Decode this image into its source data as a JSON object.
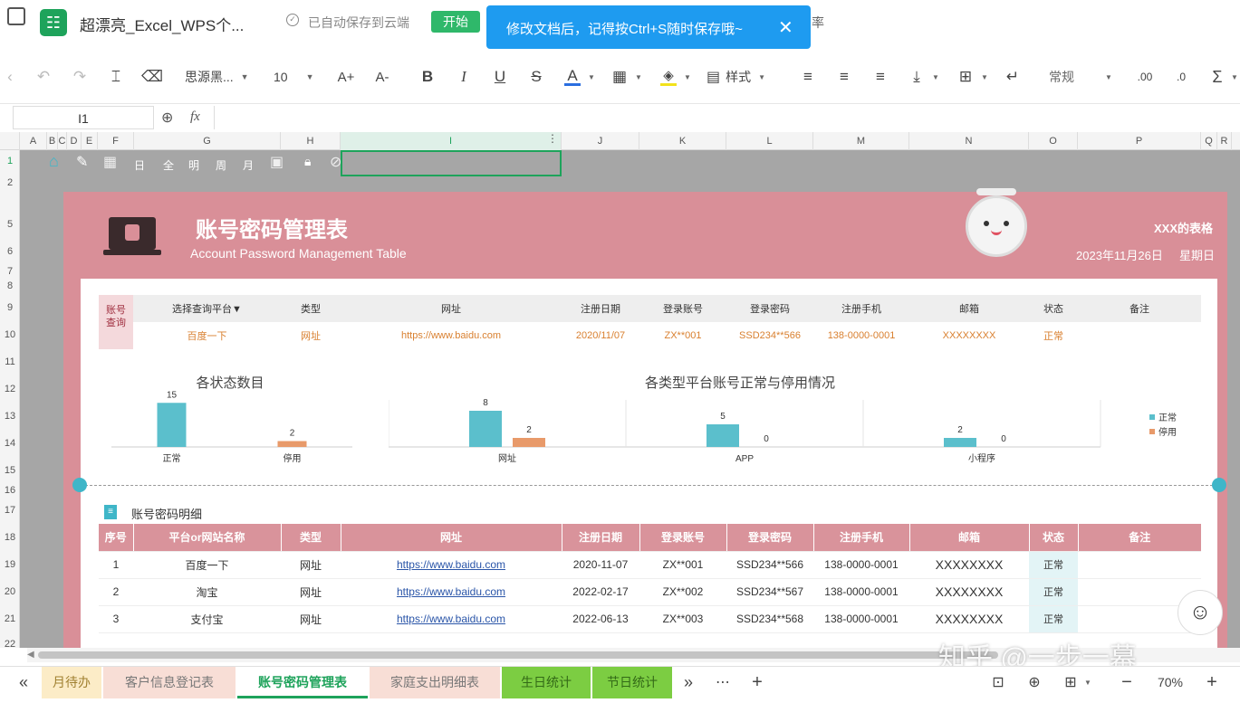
{
  "titlebar": {
    "doc_title": "超漂亮_Excel_WPS个...",
    "autosave": "已自动保存到云端",
    "start_button": "开始",
    "cut_text": "率",
    "notice": "修改文档后，记得按Ctrl+S随时保存哦~"
  },
  "toolbar": {
    "font_name": "思源黑...",
    "font_size": "10",
    "bold": "B",
    "italic": "I",
    "underline": "U",
    "strike": "S",
    "font_color": "A",
    "style_label": "样式",
    "number_format": "常规",
    "increase_font": "A+",
    "decrease_font": "A-",
    "decimal_a": ".00",
    "decimal_b": ".0",
    "sum": "Σ"
  },
  "formula": {
    "cell_ref": "I1",
    "fx": "fx"
  },
  "columns": [
    "A",
    "B",
    "C",
    "D",
    "E",
    "F",
    "G",
    "H",
    "I",
    "J",
    "K",
    "L",
    "M",
    "N",
    "O",
    "P",
    "Q",
    "R"
  ],
  "rows": [
    "1",
    "2",
    "5",
    "6",
    "7",
    "8",
    "9",
    "10",
    "11",
    "12",
    "13",
    "14",
    "15",
    "16",
    "17",
    "18",
    "19",
    "20",
    "21",
    "22"
  ],
  "row1_icons": [
    "home-icon",
    "pen-icon",
    "calendar-icon",
    "日",
    "全",
    "明",
    "周",
    "月",
    "image-icon",
    "lock-icon",
    "edit-chart-icon"
  ],
  "row1_texts": [
    "日",
    "全",
    "明",
    "周",
    "月"
  ],
  "header": {
    "title": "账号密码管理表",
    "subtitle": "Account Password Management Table",
    "owner": "XXX的表格",
    "date": "2023年11月26日",
    "weekday": "星期日"
  },
  "query": {
    "side_label": "账号查询",
    "headers": [
      "选择查询平台▼",
      "类型",
      "网址",
      "注册日期",
      "登录账号",
      "登录密码",
      "注册手机",
      "邮箱",
      "状态",
      "备注"
    ],
    "row": [
      "百度一下",
      "网址",
      "https://www.baidu.com",
      "2020/11/07",
      "ZX**001",
      "SSD234**566",
      "138-0000-0001",
      "XXXXXXXX",
      "正常",
      ""
    ]
  },
  "chart_data": [
    {
      "type": "bar",
      "title": "各状态数目",
      "categories": [
        "正常",
        "停用"
      ],
      "values": [
        15,
        2
      ],
      "colors": [
        "#5bbfcc",
        "#e89a6a"
      ],
      "ylim": [
        0,
        16
      ]
    },
    {
      "type": "bar",
      "title": "各类型平台账号正常与停用情况",
      "categories": [
        "网址",
        "APP",
        "小程序"
      ],
      "series": [
        {
          "name": "正常",
          "values": [
            8,
            5,
            2
          ],
          "color": "#5bbfcc"
        },
        {
          "name": "停用",
          "values": [
            2,
            0,
            0
          ],
          "color": "#e89a6a"
        }
      ],
      "legend": "right",
      "ylim": [
        0,
        9
      ]
    }
  ],
  "detail": {
    "section_title": "账号密码明细",
    "headers": [
      "序号",
      "平台or网站名称",
      "类型",
      "网址",
      "注册日期",
      "登录账号",
      "登录密码",
      "注册手机",
      "邮箱",
      "状态",
      "备注"
    ],
    "rows": [
      [
        "1",
        "百度一下",
        "网址",
        "https://www.baidu.com",
        "2020-11-07",
        "ZX**001",
        "SSD234**566",
        "138-0000-0001",
        "XXXXXXXX",
        "正常",
        ""
      ],
      [
        "2",
        "淘宝",
        "网址",
        "https://www.baidu.com",
        "2022-02-17",
        "ZX**002",
        "SSD234**567",
        "138-0000-0001",
        "XXXXXXXX",
        "正常",
        ""
      ],
      [
        "3",
        "支付宝",
        "网址",
        "https://www.baidu.com",
        "2022-06-13",
        "ZX**003",
        "SSD234**568",
        "138-0000-0001",
        "XXXXXXXX",
        "正常",
        ""
      ]
    ]
  },
  "tabs": [
    "月待办",
    "客户信息登记表",
    "账号密码管理表",
    "家庭支出明细表",
    "生日统计",
    "节日统计"
  ],
  "active_tab": "账号密码管理表",
  "status": {
    "zoom": "70%",
    "minus": "−",
    "plus": "+"
  },
  "watermark": "知乎 @一步一幕",
  "colors": {
    "sheet_pink": "#d98f98",
    "header_pink": "#d9939b",
    "accent_green": "#1ea35b",
    "notice_blue": "#1e9bf0"
  }
}
